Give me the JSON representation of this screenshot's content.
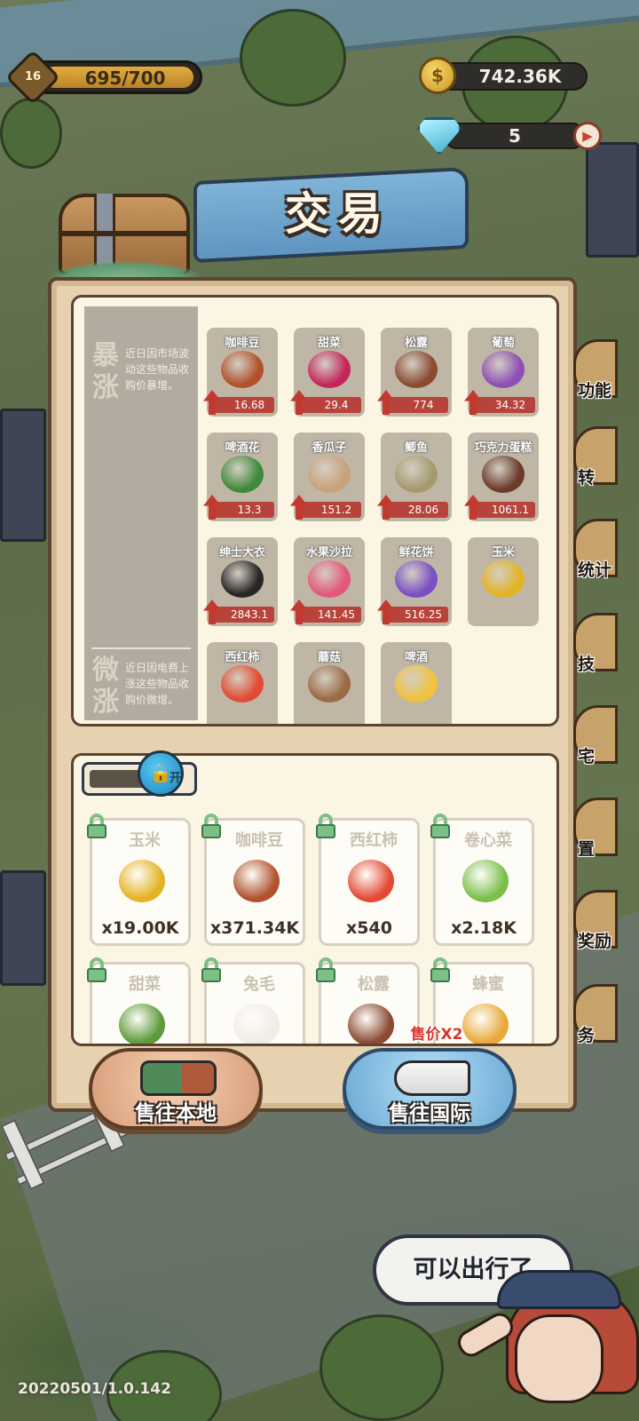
{
  "hud": {
    "level": "16",
    "xp_text": "695/700",
    "xp_progress": 0.993,
    "coins": "742.36K",
    "gems": "5",
    "coin_icon": "coin-icon",
    "gem_icon": "diamond-icon",
    "gem_add_icon": "play-icon"
  },
  "title": "交易",
  "market": {
    "sections": [
      {
        "tag": "暴涨",
        "description": "近日因市场波动这些物品收购价暴增。"
      },
      {
        "tag": "微涨",
        "description": "近日因电费上涨这些物品收购价微增。"
      }
    ],
    "goods": [
      {
        "name": "咖啡豆",
        "price": "16.68",
        "color": "#b0522c"
      },
      {
        "name": "甜菜",
        "price": "29.4",
        "color": "#c4265a"
      },
      {
        "name": "松露",
        "price": "774",
        "color": "#8a4b32"
      },
      {
        "name": "葡萄",
        "price": "34.32",
        "color": "#8d4fb3"
      },
      {
        "name": "啤酒花",
        "price": "13.3",
        "color": "#3f8a3a"
      },
      {
        "name": "香瓜子",
        "price": "151.2",
        "color": "#c8a27a"
      },
      {
        "name": "鲫鱼",
        "price": "28.06",
        "color": "#a59a6e"
      },
      {
        "name": "巧克力蛋糕",
        "price": "1061.1",
        "color": "#6b3b2b"
      },
      {
        "name": "绅士大衣",
        "price": "2843.1",
        "color": "#262626"
      },
      {
        "name": "水果沙拉",
        "price": "141.45",
        "color": "#e2577a"
      },
      {
        "name": "鲜花饼",
        "price": "516.25",
        "color": "#7a4fc4"
      },
      {
        "name": "玉米",
        "price": "",
        "color": "#e3b326"
      },
      {
        "name": "西红柿",
        "price": "",
        "color": "#e24a32"
      },
      {
        "name": "蘑菇",
        "price": "",
        "color": "#9b6a46"
      },
      {
        "name": "啤酒",
        "price": "",
        "color": "#f0c23e"
      }
    ]
  },
  "inventory": {
    "lock_state": "开",
    "items": [
      {
        "name": "玉米",
        "qty": "x19.00K",
        "color": "#e3b326"
      },
      {
        "name": "咖啡豆",
        "qty": "x371.34K",
        "color": "#b0522c"
      },
      {
        "name": "西红柿",
        "qty": "x540",
        "color": "#e24a32"
      },
      {
        "name": "卷心菜",
        "qty": "x2.18K",
        "color": "#7bbf4a"
      },
      {
        "name": "甜菜",
        "qty": "",
        "color": "#5c9a3a"
      },
      {
        "name": "兔毛",
        "qty": "",
        "color": "#f0ece6"
      },
      {
        "name": "松露",
        "qty": "",
        "color": "#8a4b32"
      },
      {
        "name": "蜂蜜",
        "qty": "",
        "color": "#e8a93a"
      }
    ]
  },
  "buttons": {
    "sell_local": "售往本地",
    "sell_intl": "售往国际",
    "sell_bonus": "售价X2"
  },
  "side_menu": [
    "功能",
    "转",
    "统计",
    "技",
    "宅",
    "置",
    "奖励",
    "务"
  ],
  "bubble": "可以出行了",
  "version": "20220501/1.0.142"
}
